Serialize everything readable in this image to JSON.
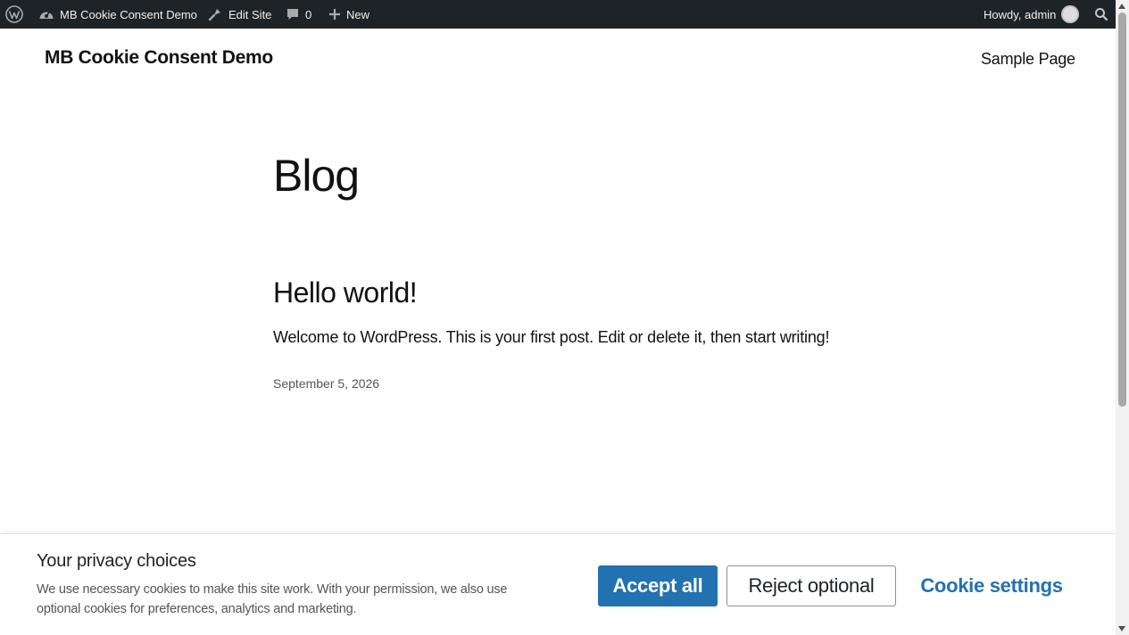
{
  "adminbar": {
    "site_name": "MB Cookie Consent Demo",
    "edit_site": "Edit Site",
    "comments_count": "0",
    "new_label": "New",
    "howdy": "Howdy, admin"
  },
  "header": {
    "site_title": "MB Cookie Consent Demo",
    "nav_item": "Sample Page"
  },
  "main": {
    "page_heading": "Blog",
    "post": {
      "title": "Hello world!",
      "excerpt": "Welcome to WordPress. This is your first post. Edit or delete it, then start writing!",
      "date": "September 5, 2026"
    }
  },
  "cookie_banner": {
    "title": "Your privacy choices",
    "text": "We use necessary cookies to make this site work. With your permission, we also use optional cookies for preferences, analytics and marketing.",
    "accept_label": "Accept all",
    "reject_label": "Reject optional",
    "settings_label": "Cookie settings"
  },
  "icons": {
    "wp_logo": "wordpress-logo-icon",
    "dashboard": "dashboard-gauge-icon",
    "edit": "brush-icon",
    "comments": "comment-bubble-icon",
    "new": "plus-icon",
    "avatar": "avatar",
    "search": "search-icon"
  },
  "colors": {
    "adminbar_bg": "#1d2327",
    "accent": "#2271b1",
    "text": "#111111"
  }
}
